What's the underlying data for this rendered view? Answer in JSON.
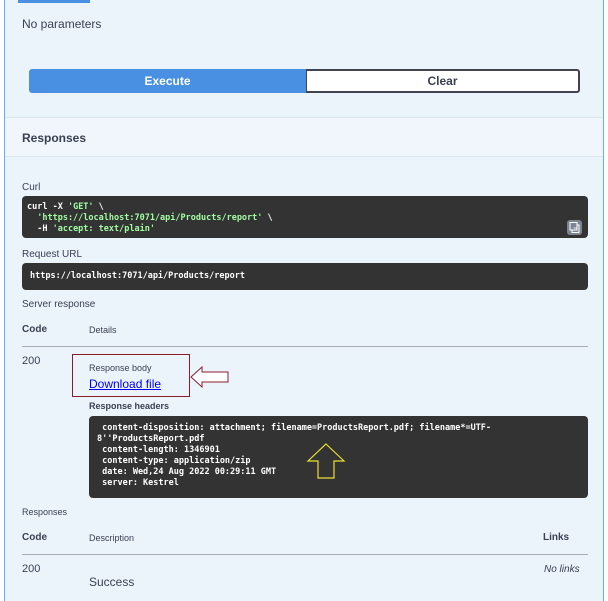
{
  "parameters": {
    "empty_text": "No parameters"
  },
  "actions": {
    "execute_label": "Execute",
    "clear_label": "Clear"
  },
  "responses_section": {
    "title": "Responses"
  },
  "curl": {
    "label": "Curl",
    "line1_cmd": "curl -X ",
    "line1_method": "'GET'",
    "line1_end": " \\",
    "line2_url": "  'https://localhost:7071/api/Products/report'",
    "line2_end": " \\",
    "line3_flag": "  -H ",
    "line3_header": "'accept: text/plain'"
  },
  "request_url": {
    "label": "Request URL",
    "value": "https://localhost:7071/api/Products/report"
  },
  "server_response": {
    "label": "Server response",
    "col_code": "Code",
    "col_details": "Details",
    "code": "200",
    "response_body_label": "Response body",
    "download_text": "Download file",
    "response_headers_label": "Response headers",
    "headers_text": " content-disposition: attachment; filename=ProductsReport.pdf; filename*=UTF-\n8''ProductsReport.pdf\n content-length: 1346901\n content-type: application/zip\n date: Wed,24 Aug 2022 00:29:11 GMT\n server: Kestrel"
  },
  "responses_table": {
    "label": "Responses",
    "col_code": "Code",
    "col_description": "Description",
    "col_links": "Links",
    "rows": [
      {
        "code": "200",
        "description": "Success",
        "links": "No links"
      }
    ]
  },
  "colors": {
    "execute_bg": "#4990e2",
    "panel_bg": "#ebf3fb",
    "code_bg": "#333333",
    "annotation_red": "#8b1c2c",
    "annotation_yellow": "#e8e030"
  }
}
